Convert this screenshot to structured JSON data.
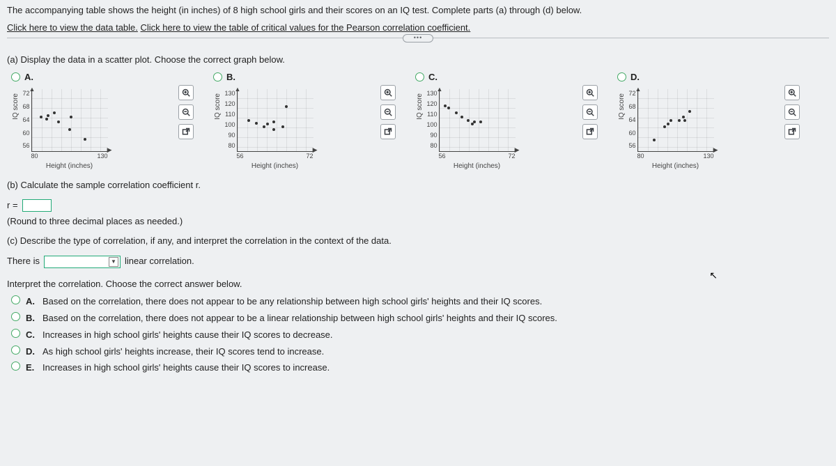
{
  "instructions": "The accompanying table shows the height (in inches) of 8 high school girls and their scores on an IQ test. Complete parts (a) through (d) below.",
  "link1": "Click here to view the data table.",
  "link2": "Click here to view the table of critical values for the Pearson correlation coefficient.",
  "partA": {
    "prompt": "(a) Display the data in a scatter plot. Choose the correct graph below.",
    "options": [
      "A.",
      "B.",
      "C.",
      "D."
    ]
  },
  "axis": {
    "xlabel": "Height (inches)",
    "ylabel": "IQ score"
  },
  "chartA": {
    "yticks": [
      "72",
      "68",
      "64",
      "60",
      "56"
    ],
    "xticks": [
      "80",
      "130"
    ],
    "points": [
      {
        "x": 12,
        "y": 55
      },
      {
        "x": 20,
        "y": 52
      },
      {
        "x": 22,
        "y": 58
      },
      {
        "x": 30,
        "y": 62
      },
      {
        "x": 35,
        "y": 48
      },
      {
        "x": 50,
        "y": 35
      },
      {
        "x": 52,
        "y": 55
      },
      {
        "x": 70,
        "y": 20
      }
    ]
  },
  "chartB": {
    "yticks": [
      "130",
      "120",
      "110",
      "100",
      "90",
      "80"
    ],
    "xticks": [
      "56",
      "72"
    ],
    "points": [
      {
        "x": 15,
        "y": 50
      },
      {
        "x": 25,
        "y": 45
      },
      {
        "x": 35,
        "y": 40
      },
      {
        "x": 40,
        "y": 44
      },
      {
        "x": 48,
        "y": 48
      },
      {
        "x": 60,
        "y": 40
      },
      {
        "x": 65,
        "y": 72
      },
      {
        "x": 48,
        "y": 35
      }
    ]
  },
  "chartC": {
    "yticks": [
      "130",
      "120",
      "110",
      "100",
      "90",
      "80"
    ],
    "xticks": [
      "56",
      "72"
    ],
    "points": [
      {
        "x": 8,
        "y": 74
      },
      {
        "x": 12,
        "y": 70
      },
      {
        "x": 22,
        "y": 62
      },
      {
        "x": 30,
        "y": 55
      },
      {
        "x": 38,
        "y": 50
      },
      {
        "x": 46,
        "y": 48
      },
      {
        "x": 55,
        "y": 48
      },
      {
        "x": 44,
        "y": 44
      }
    ]
  },
  "chartD": {
    "yticks": [
      "72",
      "68",
      "64",
      "60",
      "56"
    ],
    "xticks": [
      "80",
      "130"
    ],
    "points": [
      {
        "x": 22,
        "y": 18
      },
      {
        "x": 35,
        "y": 40
      },
      {
        "x": 40,
        "y": 44
      },
      {
        "x": 44,
        "y": 50
      },
      {
        "x": 55,
        "y": 50
      },
      {
        "x": 60,
        "y": 55
      },
      {
        "x": 62,
        "y": 50
      },
      {
        "x": 68,
        "y": 65
      }
    ]
  },
  "partB": {
    "prompt": "(b) Calculate the sample correlation coefficient r.",
    "r_label": "r =",
    "round": "(Round to three decimal places as needed.)"
  },
  "partC": {
    "prompt": "(c) Describe the type of correlation, if any, and interpret the correlation in the context of the data.",
    "thereis": "There is",
    "linear": "linear correlation.",
    "interpret": "Interpret the correlation. Choose the correct answer below.",
    "choices": {
      "A": "Based on the correlation, there does not appear to be any relationship between high school girls' heights and their IQ scores.",
      "B": "Based on the correlation, there does not appear to be a linear relationship between high school girls' heights and their IQ scores.",
      "C": "Increases in high school girls' heights cause their IQ scores to decrease.",
      "D": "As high school girls' heights increase, their IQ scores tend to increase.",
      "E": "Increases in high school girls' heights cause their IQ scores to increase."
    }
  },
  "optLabels": {
    "A": "A.",
    "B": "B.",
    "C": "C.",
    "D": "D.",
    "E": "E."
  }
}
